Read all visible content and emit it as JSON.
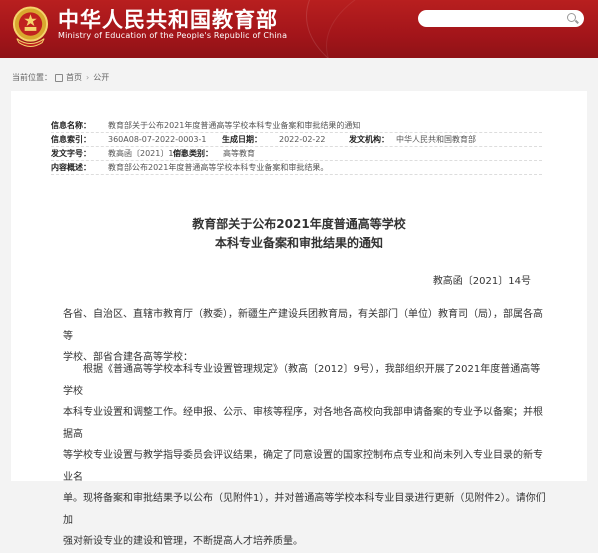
{
  "header": {
    "title": "中华人民共和国教育部",
    "subtitle": "Ministry of Education of the People's Republic of China",
    "colors": {
      "primary": "#a3151a",
      "emblem": "#f2c94c"
    },
    "search": {
      "value": "",
      "icon": "search-icon"
    }
  },
  "breadcrumb": {
    "label": "当前位置：",
    "items": [
      "首页",
      "公开"
    ],
    "separator": "›"
  },
  "info": {
    "title_label": "信息名称：",
    "title_value": "教育部关于公布2021年度普通高等学校本科专业备案和审批结果的通知",
    "index_label": "信息索引：",
    "index_value": "360A08-07-2022-0003-1",
    "date_label": "生成日期：",
    "date_value": "2022-02-22",
    "issuer_label": "发文机构：",
    "issuer_value": "中华人民共和国教育部",
    "doc_no_label": "发文字号：",
    "doc_no_value": "教高函〔2021〕14号",
    "category_label": "信息类别：",
    "category_value": "高等教育",
    "summary_label": "内容概述：",
    "summary_value": "教育部公布2021年度普通高等学校本科专业备案和审批结果。"
  },
  "document": {
    "title_line1": "教育部关于公布2021年度普通高等学校",
    "title_line2": "本科专业备案和审批结果的通知",
    "number": "教高函〔2021〕14号",
    "addressee_line1": "各省、自治区、直辖市教育厅（教委），新疆生产建设兵团教育局，有关部门（单位）教育司（局），部属各高等",
    "addressee_line2": "学校、部省合建各高等学校：",
    "para1_line1": "根据《普通高等学校本科专业设置管理规定》（教高〔2012〕9号），我部组织开展了2021年度普通高等学校",
    "para1_line2": "本科专业设置和调整工作。经申报、公示、审核等程序，对各地各高校向我部申请备案的专业予以备案；并根据高",
    "para1_line3": "等学校专业设置与教学指导委员会评议结果，确定了同意设置的国家控制布点专业和尚未列入专业目录的新专业名",
    "para1_line4": "单。现将备案和审批结果予以公布（见附件1），并对普通高等学校本科专业目录进行更新（见附件2）。请你们加",
    "para1_line5": "强对新设专业的建设和管理，不断提高人才培养质量。"
  }
}
